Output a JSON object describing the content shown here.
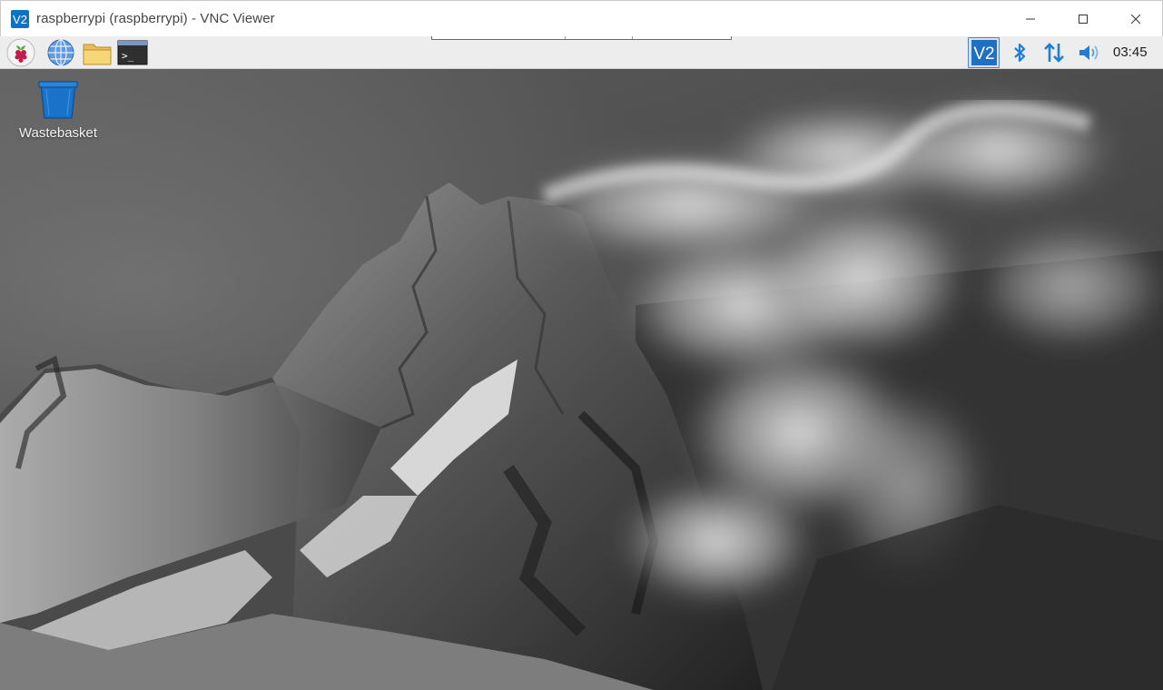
{
  "window": {
    "title": "raspberrypi (raspberrypi) - VNC Viewer",
    "app_icon_text": "V2",
    "controls": [
      "minimize",
      "maximize",
      "close"
    ]
  },
  "taskbar": {
    "launchers": [
      {
        "name": "raspberry-menu",
        "icon": "raspberry-icon"
      },
      {
        "name": "web-browser",
        "icon": "globe-icon"
      },
      {
        "name": "file-manager",
        "icon": "folder-icon"
      },
      {
        "name": "terminal",
        "icon": "terminal-icon",
        "glyph": ">_"
      }
    ],
    "tray": {
      "vnc_icon_text": "V2",
      "icons": [
        "vnc-server-icon",
        "bluetooth-icon",
        "network-icon",
        "volume-icon"
      ],
      "clock": "03:45"
    }
  },
  "desktop": {
    "icons": [
      {
        "label": "Wastebasket",
        "icon": "wastebasket-icon"
      }
    ],
    "wallpaper": "black-and-white snowy mountain peak with clouds"
  },
  "colors": {
    "vnc_blue": "#0e72c4",
    "tray_blue": "#1f7fd6",
    "taskbar_bg": "#ededed",
    "titlebar_bg": "#ffffff"
  }
}
